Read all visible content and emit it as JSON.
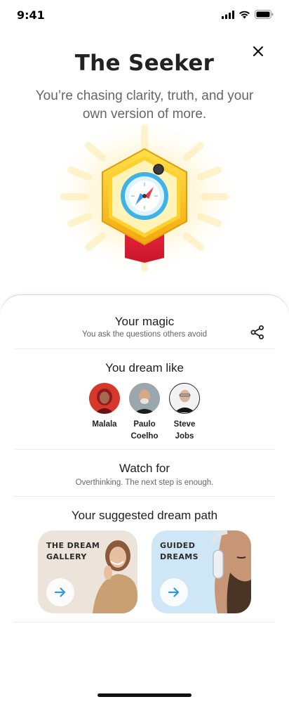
{
  "status_bar": {
    "time": "9:41"
  },
  "header": {
    "title": "The Seeker",
    "subtitle": "You’re chasing clarity, truth, and your own version of more."
  },
  "magic": {
    "title": "Your magic",
    "description": "You ask the questions others avoid"
  },
  "dream_like": {
    "title": "You dream like",
    "people": [
      {
        "name": "Malala"
      },
      {
        "name": "Paulo\nCoelho"
      },
      {
        "name": "Steve\nJobs"
      }
    ]
  },
  "watch_for": {
    "title": "Watch for",
    "description": "Overthinking. The next step is enough."
  },
  "dream_path": {
    "title": "Your suggested dream path",
    "cards": [
      {
        "label": "THE DREAM\nGALLERY",
        "background": "#ece3da"
      },
      {
        "label": "GUIDED\nDREAMS",
        "background": "#cfe6f6"
      }
    ]
  },
  "colors": {
    "accent_blue": "#2b9be0",
    "badge_gold": "#f6c21c",
    "ribbon_red": "#d81e34"
  },
  "icons": {
    "close": "close-icon",
    "share": "share-icon",
    "badge": "compass-icon",
    "card_arrow": "arrow-right-icon"
  }
}
